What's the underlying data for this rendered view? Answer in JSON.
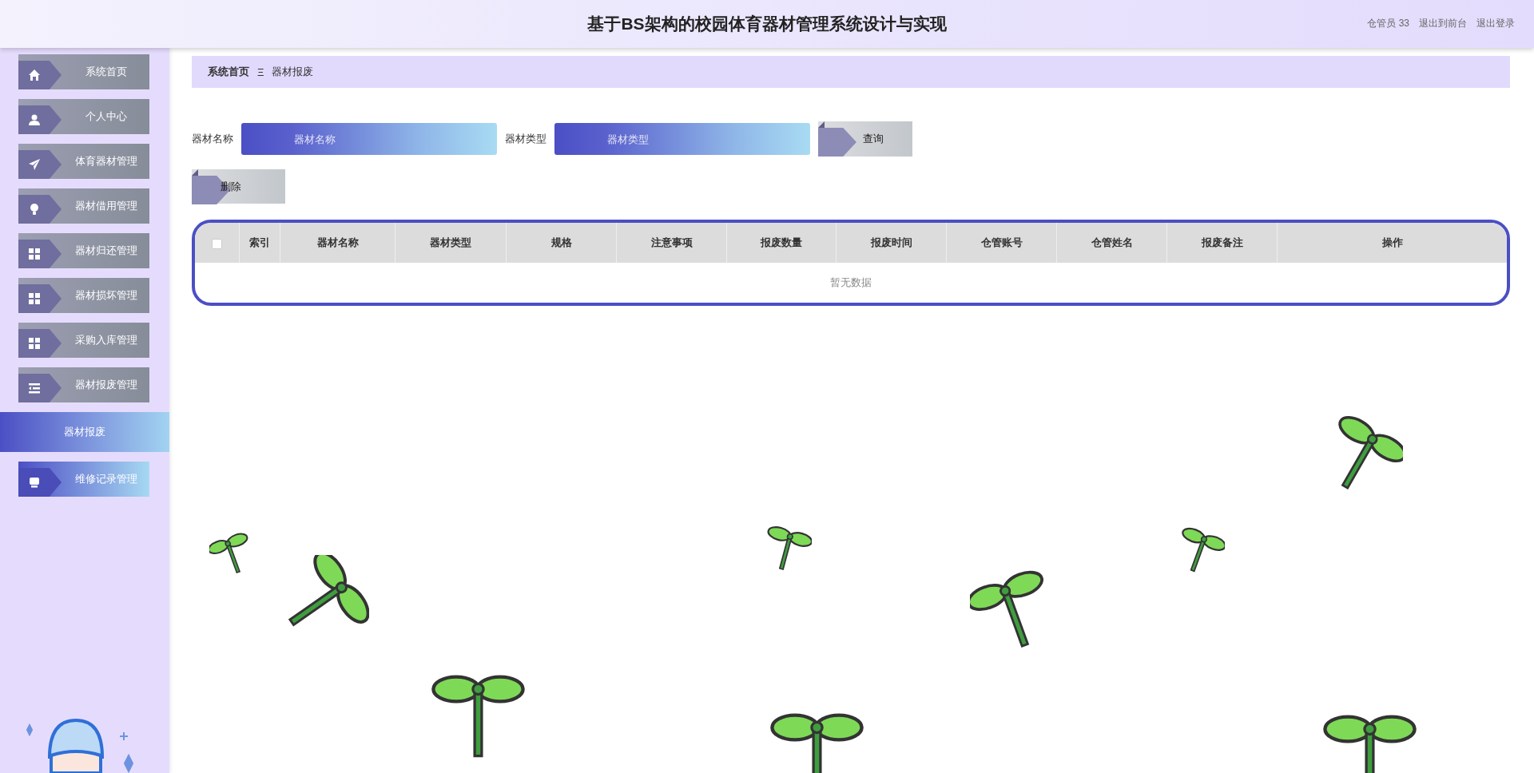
{
  "header": {
    "title": "基于BS架构的校园体育器材管理系统设计与实现",
    "user": "仓管员 33",
    "links": [
      "退出到前台",
      "退出登录"
    ]
  },
  "sidebar": {
    "items": [
      {
        "label": "系统首页",
        "selected": false,
        "hovered": false
      },
      {
        "label": "个人中心",
        "selected": false,
        "hovered": false
      },
      {
        "label": "体育器材管理",
        "selected": false,
        "hovered": false
      },
      {
        "label": "器材借用管理",
        "selected": false,
        "hovered": false
      },
      {
        "label": "器材归还管理",
        "selected": false,
        "hovered": false
      },
      {
        "label": "器材损坏管理",
        "selected": false,
        "hovered": false
      },
      {
        "label": "采购入库管理",
        "selected": false,
        "hovered": false
      },
      {
        "label": "器材报废管理",
        "selected": false,
        "hovered": false,
        "expanded": true,
        "children": [
          {
            "label": "器材报废",
            "selected": true
          }
        ]
      },
      {
        "label": "维修记录管理",
        "selected": false,
        "hovered": true
      }
    ]
  },
  "breadcrumb": {
    "items": [
      "系统首页",
      "器材报废"
    ],
    "separator": "Ξ"
  },
  "search": {
    "fields": [
      {
        "label": "器材名称",
        "placeholder": "器材名称"
      },
      {
        "label": "器材类型",
        "placeholder": "器材类型"
      }
    ],
    "query_button": "查询"
  },
  "actions": {
    "delete_button": "删除"
  },
  "table": {
    "select_all_checked": false,
    "columns": [
      "索引",
      "器材名称",
      "器材类型",
      "规格",
      "注意事项",
      "报废数量",
      "报废时间",
      "仓管账号",
      "仓管姓名",
      "报废备注",
      "操作"
    ],
    "empty_text": "暂无数据"
  }
}
